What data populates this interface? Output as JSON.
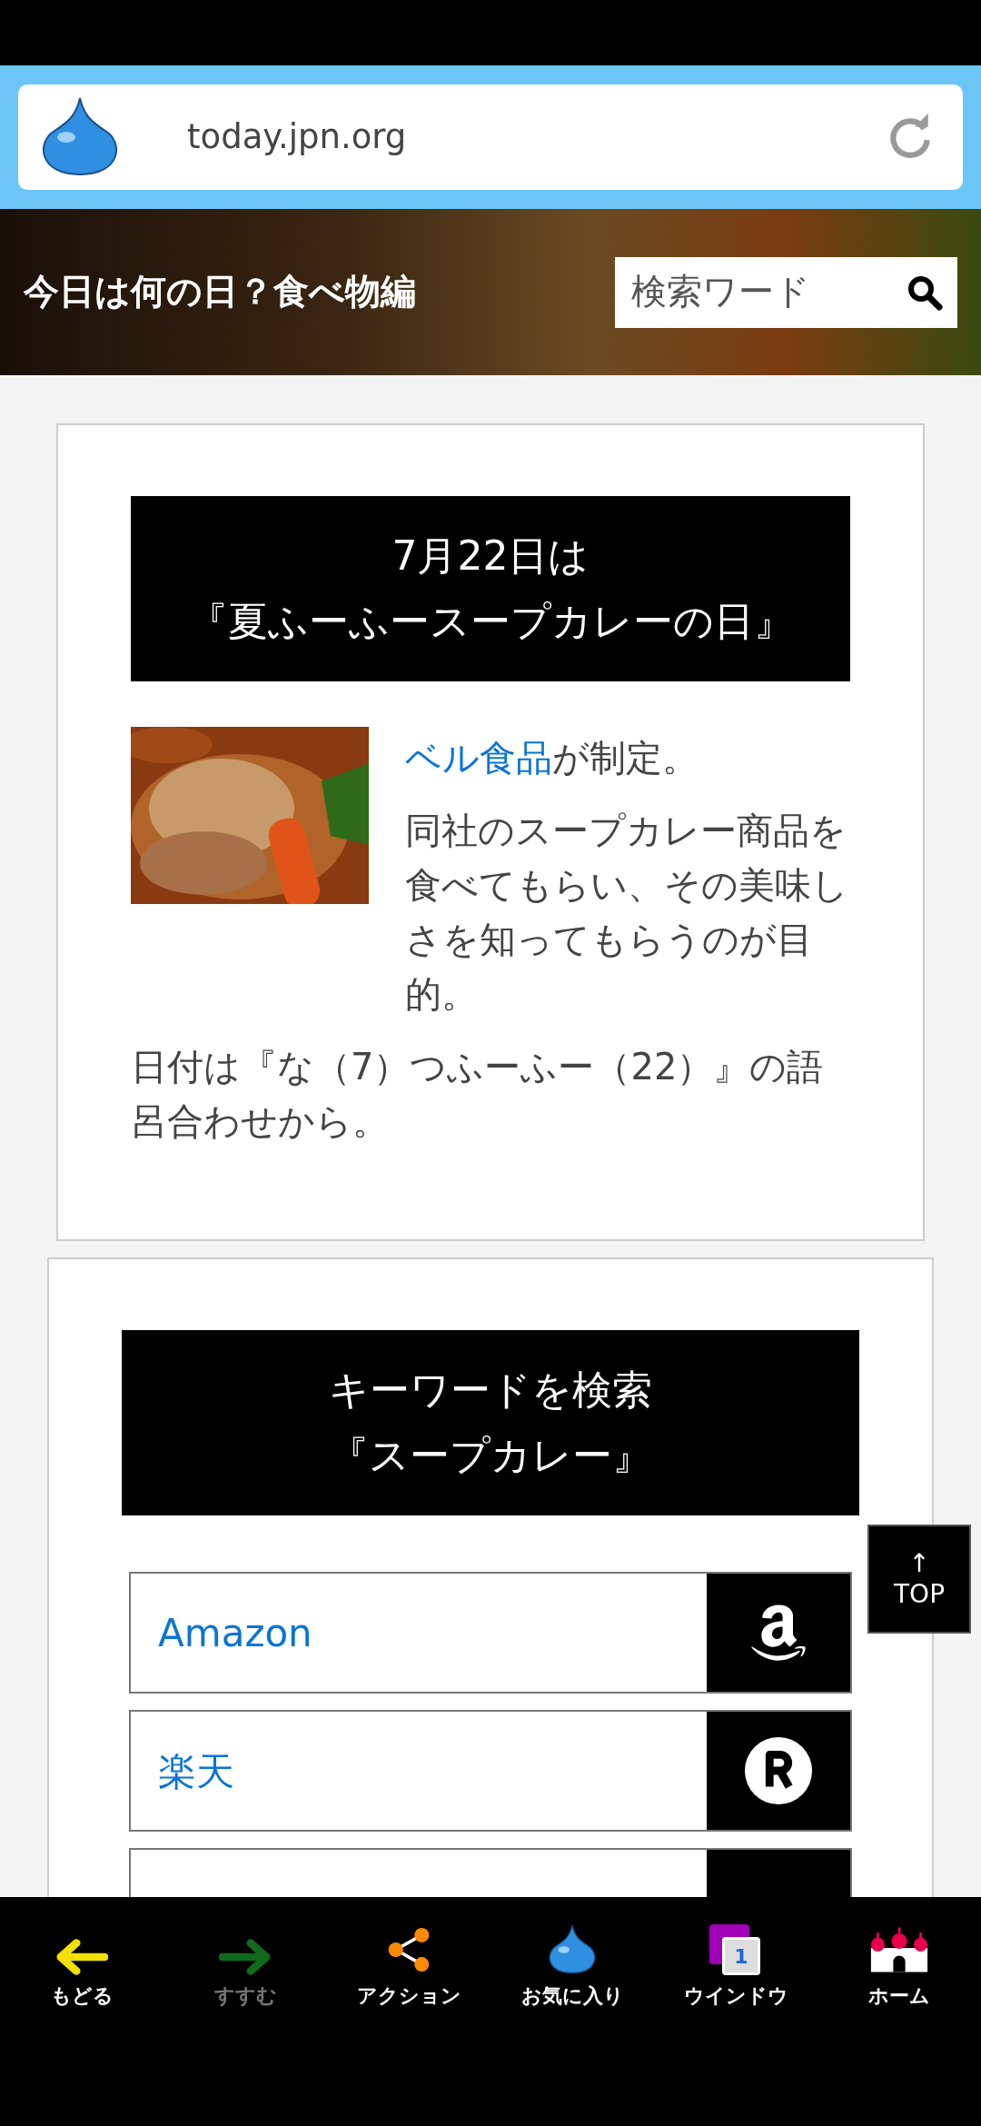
{
  "address_bar": {
    "url": "today.jpn.org"
  },
  "header": {
    "title": "今日は何の日？食べ物編",
    "search": {
      "placeholder": "検索ワード"
    }
  },
  "article": {
    "heading": [
      "7月22日は",
      "『夏ふーふースープカレーの日』"
    ],
    "paragraphs": [
      {
        "link": "ベル食品",
        "text": "が制定。"
      },
      {
        "text": "同社のスープカレー商品を食べてもらい、その美味しさを知ってもらうのが目的。"
      },
      {
        "text": "日付は『な（7）つふーふー（22）』の語呂合わせから。"
      }
    ]
  },
  "keyword_search": {
    "heading": [
      "キーワードを検索",
      "『スープカレー』"
    ],
    "links": [
      {
        "label": "Amazon",
        "kind": "amazon"
      },
      {
        "label": "楽天",
        "kind": "rakuten"
      }
    ]
  },
  "top_button": {
    "arrow": "↑",
    "label": "TOP"
  },
  "bottom_nav": [
    {
      "label": "もどる",
      "kind": "back",
      "disabled": false
    },
    {
      "label": "すすむ",
      "kind": "forward",
      "disabled": true
    },
    {
      "label": "アクション",
      "kind": "share",
      "disabled": false
    },
    {
      "label": "お気に入り",
      "kind": "favorite",
      "disabled": false
    },
    {
      "label": "ウインドウ",
      "kind": "window",
      "disabled": false,
      "count": "1"
    },
    {
      "label": "ホーム",
      "kind": "home",
      "disabled": false
    }
  ]
}
